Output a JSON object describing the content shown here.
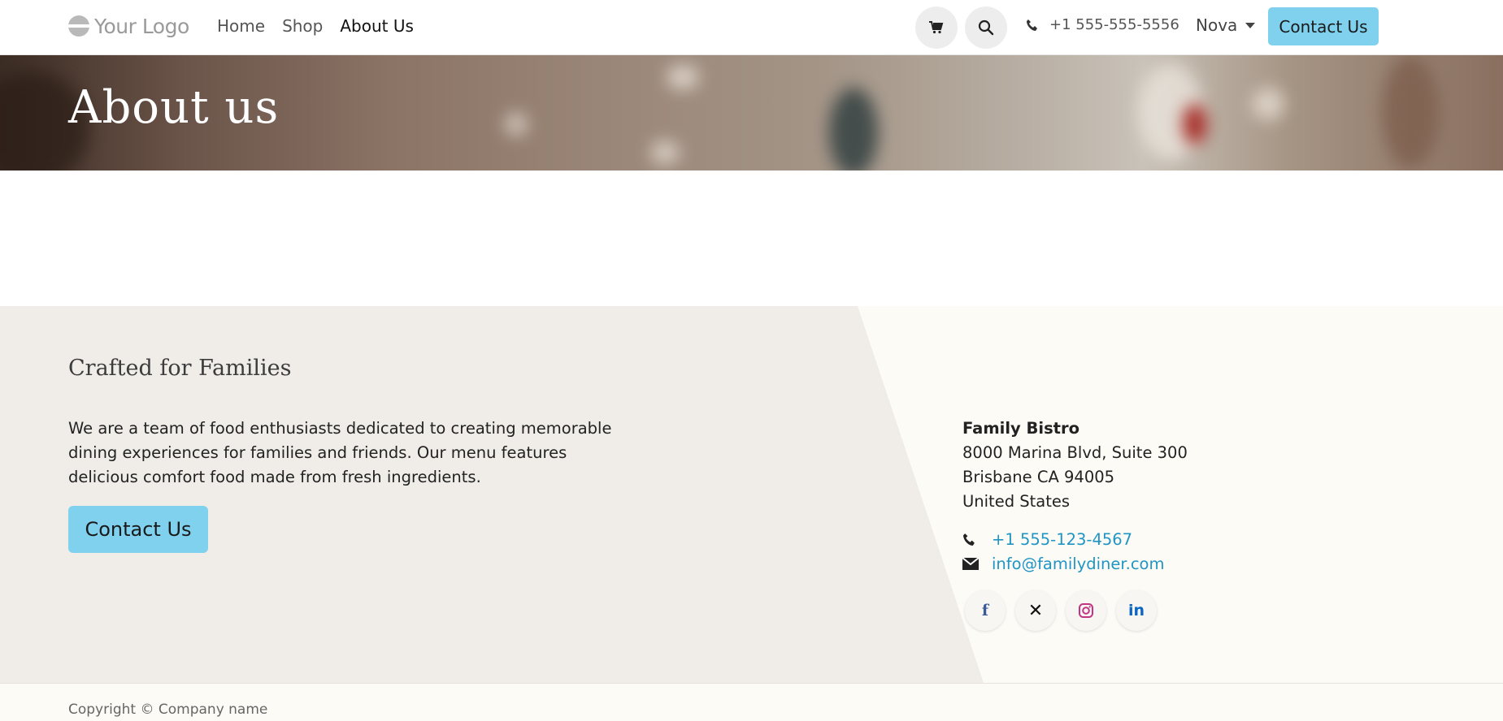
{
  "header": {
    "logo_text": "Your Logo",
    "nav": [
      {
        "label": "Home",
        "active": false
      },
      {
        "label": "Shop",
        "active": false
      },
      {
        "label": "About Us",
        "active": true
      }
    ],
    "phone": "+1 555-555-5556",
    "user": "Nova",
    "contact_button": "Contact Us"
  },
  "banner": {
    "title": "About us"
  },
  "footer": {
    "tagline": "Crafted for Families",
    "description": "We are a team of food enthusiasts dedicated to creating memorable dining experiences for families and friends. Our menu features delicious comfort food made from fresh ingredients.",
    "contact_button": "Contact Us",
    "company_name": "Family Bistro",
    "address_line1": "8000 Marina Blvd, Suite 300",
    "address_line2": "Brisbane CA 94005",
    "country": "United States",
    "phone": "+1 555-123-4567",
    "email": "info@familydiner.com",
    "socials": [
      {
        "name": "facebook-icon",
        "glyph": "f",
        "color": "#3b5998"
      },
      {
        "name": "x-icon",
        "glyph": "𝕏",
        "color": "#111111"
      },
      {
        "name": "instagram-icon",
        "glyph": "◎",
        "color": "#c13584"
      },
      {
        "name": "linkedin-icon",
        "glyph": "in",
        "color": "#0a66c2"
      }
    ]
  },
  "copyright": "Copyright © Company name",
  "colors": {
    "accent": "#7fd1ee",
    "link": "#1f95c4",
    "footer_left_bg": "#f0ede8",
    "footer_right_bg": "#fdfbf6"
  }
}
